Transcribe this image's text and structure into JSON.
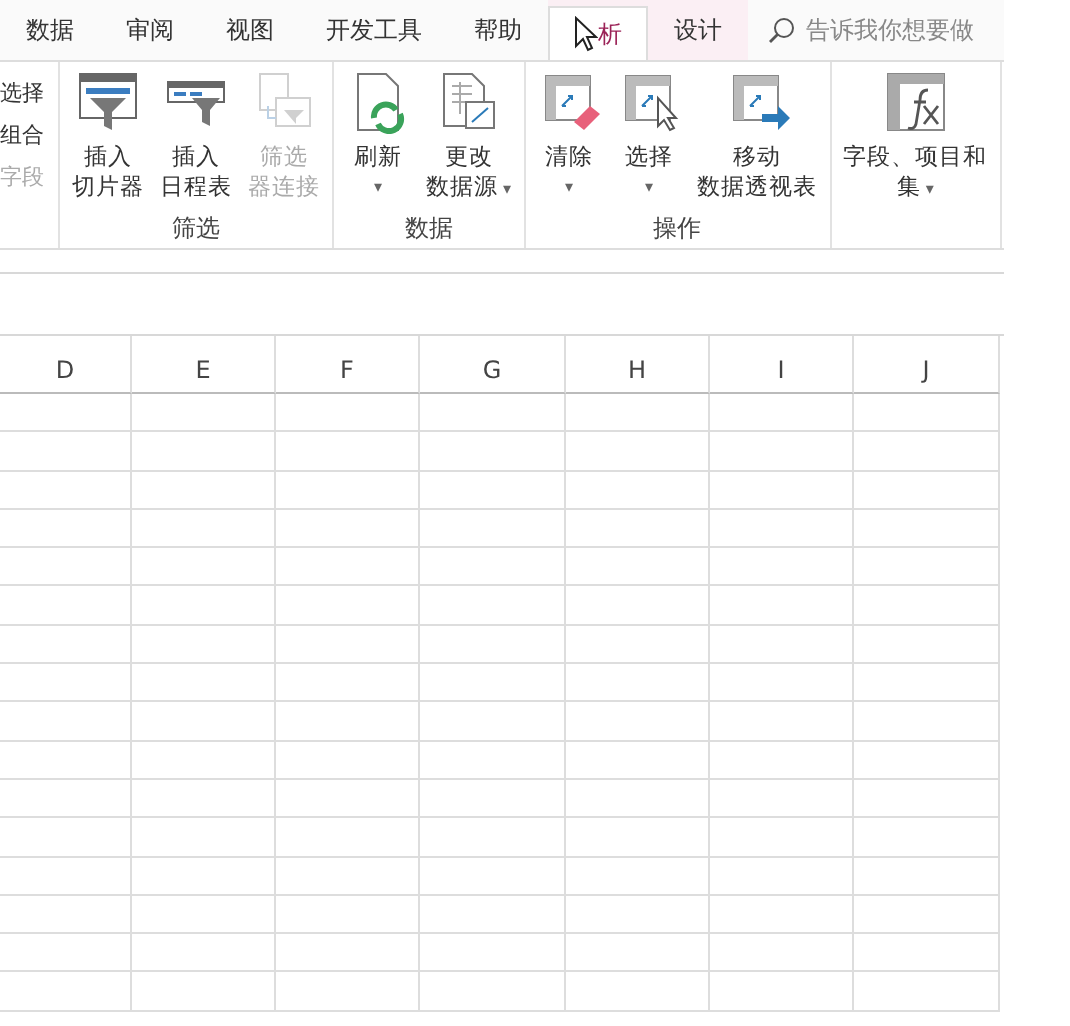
{
  "tabs": [
    {
      "label": "数据",
      "selected": false,
      "hovered": false
    },
    {
      "label": "审阅",
      "selected": false,
      "hovered": false
    },
    {
      "label": "视图",
      "selected": false,
      "hovered": false
    },
    {
      "label": "开发工具",
      "selected": false,
      "hovered": false
    },
    {
      "label": "帮助",
      "selected": false,
      "hovered": false
    }
  ],
  "contextual_tabs": [
    {
      "label": "析",
      "selected": true,
      "hovered": true
    },
    {
      "label": "设计",
      "selected": false,
      "hovered": false
    }
  ],
  "search": {
    "placeholder": "告诉我你想要做"
  },
  "ribbon": {
    "groups": [
      {
        "kind": "small",
        "items": [
          {
            "label": "选择",
            "disabled": false
          },
          {
            "label": "组合",
            "disabled": false
          },
          {
            "label": "字段",
            "disabled": true
          }
        ]
      },
      {
        "kind": "large",
        "label": "筛选",
        "items": [
          {
            "lines": [
              "插入",
              "切片器"
            ],
            "disabled": false
          },
          {
            "lines": [
              "插入",
              "日程表"
            ],
            "disabled": false
          },
          {
            "lines": [
              "筛选",
              "器连接"
            ],
            "disabled": true
          }
        ]
      },
      {
        "kind": "large",
        "label": "数据",
        "items": [
          {
            "lines": [
              "刷新"
            ],
            "disabled": false,
            "caret": "▾"
          },
          {
            "lines": [
              "更改",
              "数据源"
            ],
            "disabled": false,
            "caret": "▾"
          }
        ]
      },
      {
        "kind": "large",
        "label": "操作",
        "items": [
          {
            "lines": [
              "清除"
            ],
            "disabled": false,
            "caret": "▾"
          },
          {
            "lines": [
              "选择"
            ],
            "disabled": false,
            "caret": "▾"
          },
          {
            "lines": [
              "移动",
              "数据透视表"
            ],
            "disabled": false
          }
        ]
      },
      {
        "kind": "large",
        "items": [
          {
            "lines": [
              "字段、项目和",
              "集"
            ],
            "disabled": false,
            "caret": "▾"
          }
        ]
      }
    ]
  },
  "sheet": {
    "columns": [
      "D",
      "E",
      "F",
      "G",
      "H",
      "I",
      "J"
    ]
  }
}
